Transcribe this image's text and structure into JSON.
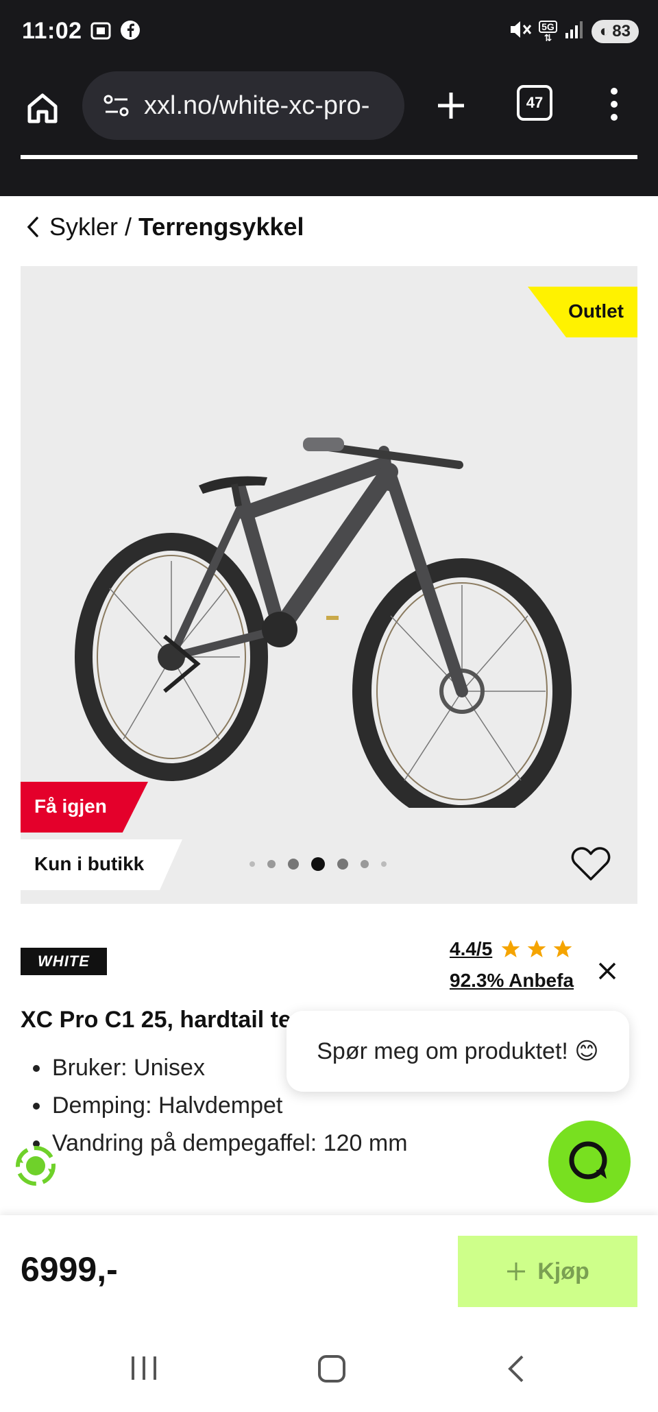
{
  "status_bar": {
    "time": "11:02",
    "battery": "83",
    "network": "5G"
  },
  "browser": {
    "url": "xxl.no/white-xc-pro-",
    "tab_count": "47"
  },
  "breadcrumb": {
    "parent": "Sykler",
    "separator": "/",
    "current": "Terrengsykkel"
  },
  "product_image": {
    "badge_outlet": "Outlet",
    "badge_back": "Få igjen",
    "badge_store": "Kun i butikk",
    "carousel_total": 7,
    "carousel_active_index": 3
  },
  "brand": {
    "name": "WHITE"
  },
  "rating": {
    "value": "4.4/5",
    "stars": 4.4,
    "recommend": "92.3% Anbefa"
  },
  "product": {
    "title": "XC Pro C1 25, hardtail te",
    "specs": [
      "Bruker: Unisex",
      "Demping: Halvdempet",
      "Vandring på dempegaffel: 120 mm"
    ]
  },
  "chat": {
    "prompt": "Spør meg om produktet! 😊"
  },
  "buy_bar": {
    "price": "6999,-",
    "buy_label": "Kjøp"
  },
  "colors": {
    "outlet": "#fff200",
    "back": "#e4002b",
    "buy_button": "#ceff8a",
    "chat_fab": "#78e020",
    "star": "#f5a400"
  }
}
